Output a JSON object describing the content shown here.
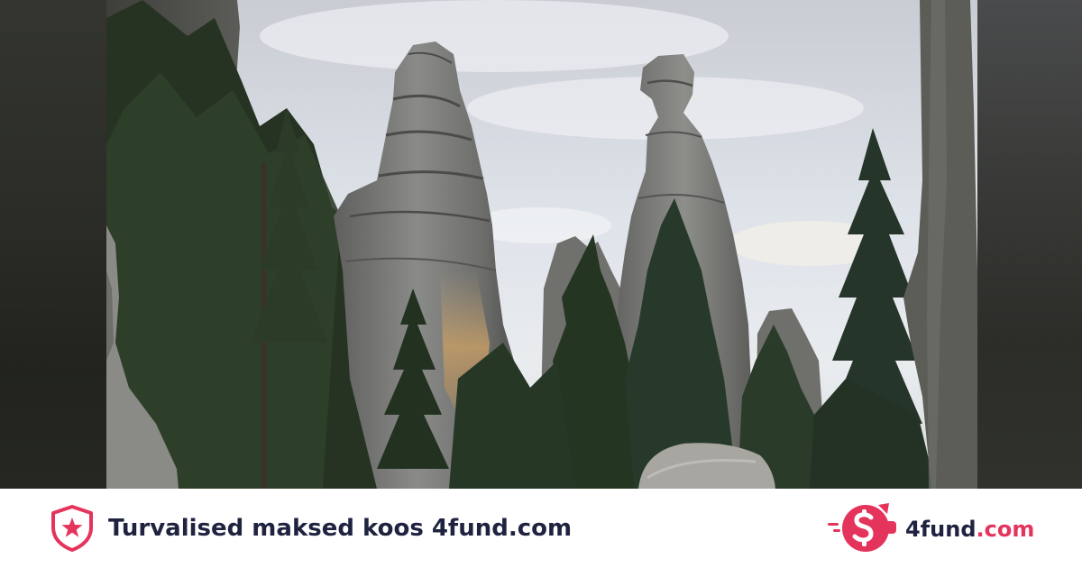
{
  "footer": {
    "tagline": "Turvalised maksed koos 4fund.com",
    "brand_name": "4fund",
    "brand_tld": ".com"
  },
  "icons": {
    "shield": "shield-star-icon",
    "brand_logo": "piggy-bank-dollar-icon"
  },
  "colors": {
    "brand_accent": "#e5345c",
    "text_dark": "#1f2340",
    "footer_bg": "#ffffff"
  }
}
